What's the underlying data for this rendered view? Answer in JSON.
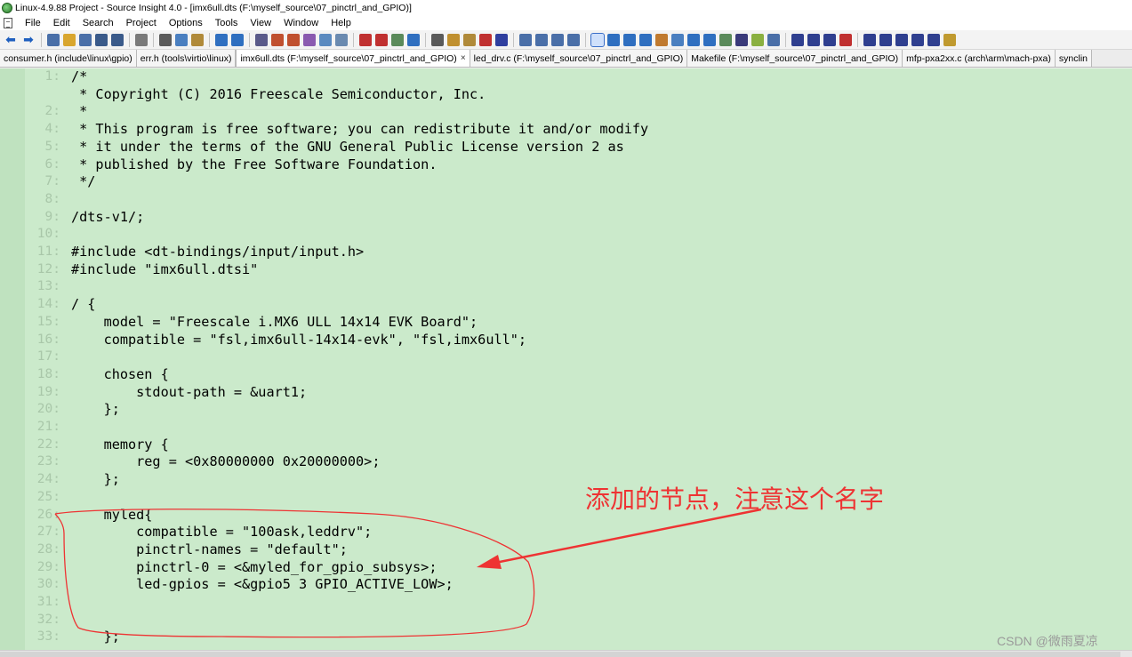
{
  "window": {
    "title": "Linux-4.9.88 Project - Source Insight 4.0 - [imx6ull.dts (F:\\myself_source\\07_pinctrl_and_GPIO)]"
  },
  "menu": [
    "File",
    "Edit",
    "Search",
    "Project",
    "Options",
    "Tools",
    "View",
    "Window",
    "Help"
  ],
  "tabs": [
    {
      "label": "consumer.h (include\\linux\\gpio)",
      "active": false
    },
    {
      "label": "err.h (tools\\virtio\\linux)",
      "active": false
    },
    {
      "label": "imx6ull.dts (F:\\myself_source\\07_pinctrl_and_GPIO)",
      "active": true
    },
    {
      "label": "led_drv.c (F:\\myself_source\\07_pinctrl_and_GPIO)",
      "active": false
    },
    {
      "label": "Makefile (F:\\myself_source\\07_pinctrl_and_GPIO)",
      "active": false
    },
    {
      "label": "mfp-pxa2xx.c (arch\\arm\\mach-pxa)",
      "active": false
    },
    {
      "label": "synclin",
      "active": false
    }
  ],
  "tab_close_glyph": "×",
  "code": [
    {
      "ln": "1:",
      "text": "/*"
    },
    {
      "ln": "",
      "text": " * Copyright (C) 2016 Freescale Semiconductor, Inc."
    },
    {
      "ln": "2:",
      "text": " *"
    },
    {
      "ln": "4:",
      "text": " * This program is free software; you can redistribute it and/or modify"
    },
    {
      "ln": "5:",
      "text": " * it under the terms of the GNU General Public License version 2 as"
    },
    {
      "ln": "6:",
      "text": " * published by the Free Software Foundation."
    },
    {
      "ln": "7:",
      "text": " */"
    },
    {
      "ln": "8:",
      "text": ""
    },
    {
      "ln": "9:",
      "text": "/dts-v1/;"
    },
    {
      "ln": "10:",
      "text": ""
    },
    {
      "ln": "11:",
      "text": "#include <dt-bindings/input/input.h>"
    },
    {
      "ln": "12:",
      "text": "#include \"imx6ull.dtsi\""
    },
    {
      "ln": "13:",
      "text": ""
    },
    {
      "ln": "14:",
      "text": "/ {"
    },
    {
      "ln": "15:",
      "text": "    model = \"Freescale i.MX6 ULL 14x14 EVK Board\";"
    },
    {
      "ln": "16:",
      "text": "    compatible = \"fsl,imx6ull-14x14-evk\", \"fsl,imx6ull\";"
    },
    {
      "ln": "17:",
      "text": ""
    },
    {
      "ln": "18:",
      "text": "    chosen {"
    },
    {
      "ln": "19:",
      "text": "        stdout-path = &uart1;"
    },
    {
      "ln": "20:",
      "text": "    };"
    },
    {
      "ln": "21:",
      "text": ""
    },
    {
      "ln": "22:",
      "text": "    memory {"
    },
    {
      "ln": "23:",
      "text": "        reg = <0x80000000 0x20000000>;"
    },
    {
      "ln": "24:",
      "text": "    };"
    },
    {
      "ln": "25:",
      "text": ""
    },
    {
      "ln": "26:",
      "text": "    myled{"
    },
    {
      "ln": "27:",
      "text": "        compatible = \"100ask,leddrv\";"
    },
    {
      "ln": "28:",
      "text": "        pinctrl-names = \"default\";"
    },
    {
      "ln": "29:",
      "text": "        pinctrl-0 = <&myled_for_gpio_subsys>;"
    },
    {
      "ln": "30:",
      "text": "        led-gpios = <&gpio5 3 GPIO_ACTIVE_LOW>;"
    },
    {
      "ln": "31:",
      "text": ""
    },
    {
      "ln": "32:",
      "text": ""
    },
    {
      "ln": "33:",
      "text": "    };"
    }
  ],
  "annotation": {
    "text": "添加的节点，注意这个名字",
    "color": "#ee3333"
  },
  "watermark": "CSDN @微雨夏凉",
  "colors": {
    "editor_bg": "#cbeacb",
    "line_number": "#a9c7a9",
    "annotation": "#ee3333"
  }
}
